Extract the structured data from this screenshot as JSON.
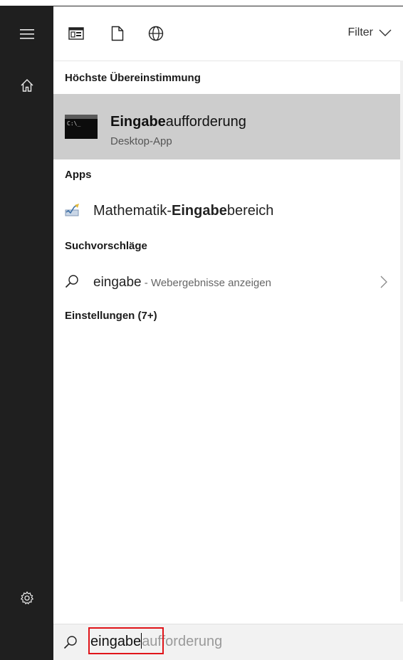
{
  "toolbar": {
    "icons": [
      "apps-filter-icon",
      "documents-filter-icon",
      "web-filter-icon"
    ],
    "filter_label": "Filter"
  },
  "sections": {
    "best_match_header": "Höchste Übereinstimmung",
    "apps_header": "Apps",
    "suggestions_header": "Suchvorschläge",
    "settings_header": "Einstellungen (7+)"
  },
  "best_match": {
    "title_bold": "Eingabe",
    "title_rest": "aufforderung",
    "subtitle": "Desktop-App",
    "icon_text": "C:\\_"
  },
  "apps": [
    {
      "prefix": "Mathematik-",
      "bold": "Eingabe",
      "suffix": "bereich"
    }
  ],
  "suggestion": {
    "query": "eingabe",
    "hint": " - Webergebnisse anzeigen"
  },
  "search": {
    "typed": "eingabe",
    "autocomplete": "aufforderung"
  },
  "colors": {
    "rail": "#1f1f1f",
    "selected_row": "#cdcdcd",
    "highlight_box": "#e0141a"
  }
}
